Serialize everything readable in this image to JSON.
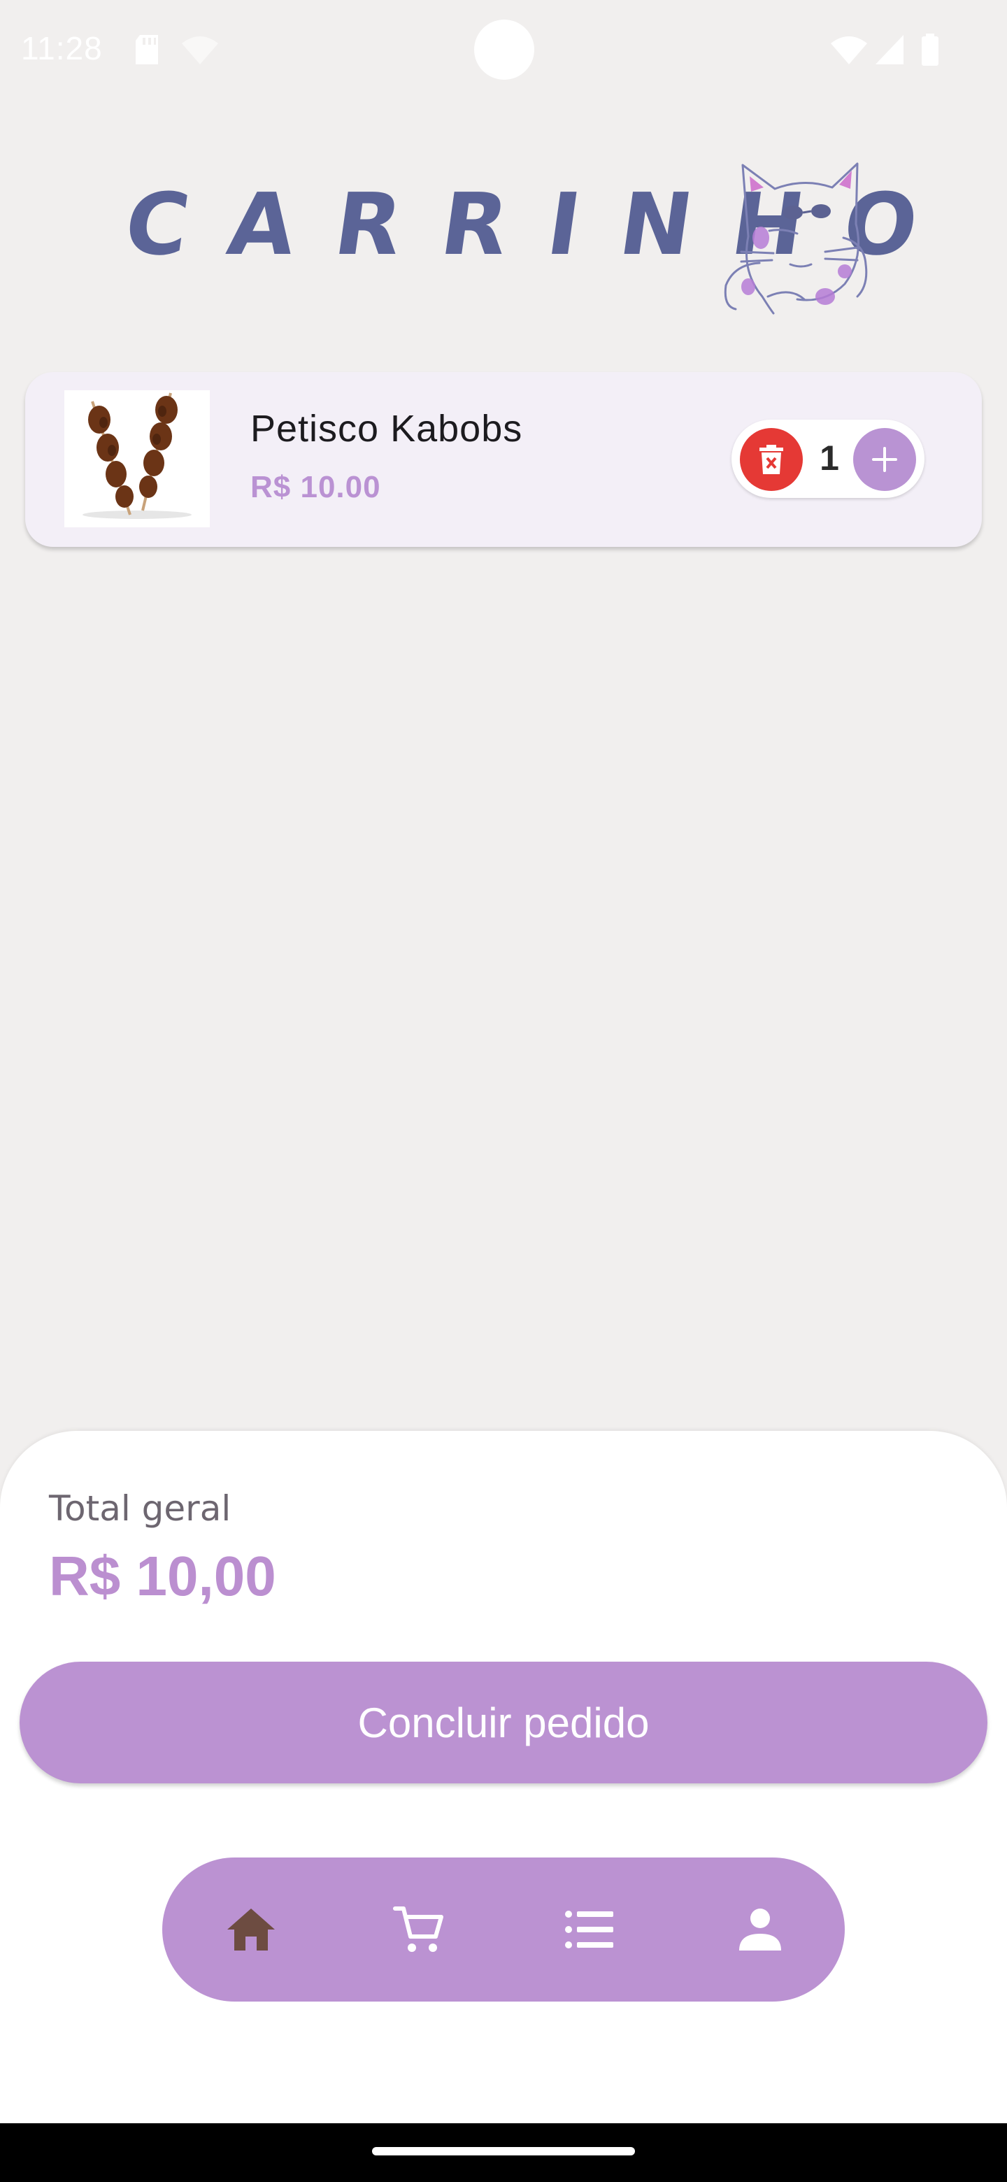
{
  "status_bar": {
    "time": "11:28"
  },
  "header": {
    "title": "CARRINHO"
  },
  "cart": {
    "items": [
      {
        "name": "Petisco Kabobs",
        "price": "R$ 10.00",
        "quantity": "1"
      }
    ]
  },
  "summary": {
    "total_label": "Total geral",
    "total_value": "R$ 10,00"
  },
  "actions": {
    "checkout_label": "Concluir pedido"
  },
  "nav": {
    "items": [
      {
        "icon": "home-icon",
        "active": true
      },
      {
        "icon": "cart-icon",
        "active": false
      },
      {
        "icon": "list-icon",
        "active": false
      },
      {
        "icon": "person-icon",
        "active": false
      }
    ]
  },
  "colors": {
    "accent": "#bb92d2",
    "price": "#ba92d3",
    "delete": "#e53935",
    "title": "#5b6497",
    "active_nav_icon": "#6d4c41",
    "background": "#f1efee"
  }
}
